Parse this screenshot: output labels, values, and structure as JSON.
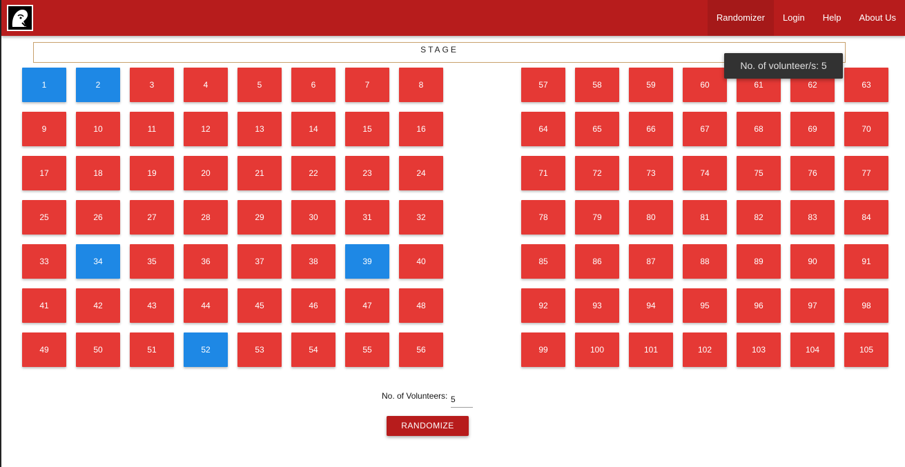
{
  "navbar": {
    "logo_icon": "profile-logo-icon",
    "links": [
      "Randomizer",
      "Login",
      "Help",
      "About Us"
    ],
    "active_link": "Randomizer"
  },
  "stage": {
    "label": "STAGE"
  },
  "seating": {
    "left_block": [
      [
        "1",
        "2",
        "3",
        "4",
        "5",
        "6",
        "7",
        "8"
      ],
      [
        "9",
        "10",
        "11",
        "12",
        "13",
        "14",
        "15",
        "16"
      ],
      [
        "17",
        "18",
        "19",
        "20",
        "21",
        "22",
        "23",
        "24"
      ],
      [
        "25",
        "26",
        "27",
        "28",
        "29",
        "30",
        "31",
        "32"
      ],
      [
        "33",
        "34",
        "35",
        "36",
        "37",
        "38",
        "39",
        "40"
      ],
      [
        "41",
        "42",
        "43",
        "44",
        "45",
        "46",
        "47",
        "48"
      ],
      [
        "49",
        "50",
        "51",
        "52",
        "53",
        "54",
        "55",
        "56"
      ]
    ],
    "right_block": [
      [
        "57",
        "58",
        "59",
        "60",
        "61",
        "62",
        "63"
      ],
      [
        "64",
        "65",
        "66",
        "67",
        "68",
        "69",
        "70"
      ],
      [
        "71",
        "72",
        "73",
        "74",
        "75",
        "76",
        "77"
      ],
      [
        "78",
        "79",
        "80",
        "81",
        "82",
        "83",
        "84"
      ],
      [
        "85",
        "86",
        "87",
        "88",
        "89",
        "90",
        "91"
      ],
      [
        "92",
        "93",
        "94",
        "95",
        "96",
        "97",
        "98"
      ],
      [
        "99",
        "100",
        "101",
        "102",
        "103",
        "104",
        "105"
      ]
    ],
    "selected": [
      "1",
      "2",
      "34",
      "39",
      "52"
    ],
    "colors": {
      "seat": "#e53935",
      "selected": "#1e88e5",
      "navbar": "#b71c1c"
    }
  },
  "tooltip": {
    "text": "No. of volunteer/s: 5"
  },
  "controls": {
    "volunteers_label": "No. of Volunteers:",
    "volunteers_value": "5",
    "randomize_label": "RANDOMIZE"
  }
}
